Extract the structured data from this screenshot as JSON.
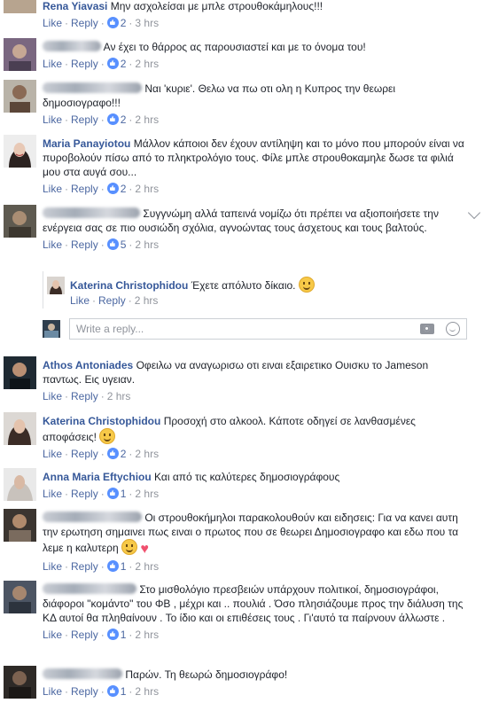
{
  "actions": {
    "like": "Like",
    "reply": "Reply",
    "sep": "·"
  },
  "comments": [
    {
      "name": "Rena Yiavasi",
      "text": "Μην ασχολείσαι με μπλε στρουθοκάμηλους!!!",
      "reactions": "2",
      "time": "3 hrs"
    },
    {
      "name": "",
      "text": "Αν έχει το θάρρος ας παρουσιαστεί και με το όνομα του!",
      "reactions": "2",
      "time": "2 hrs"
    },
    {
      "name": "",
      "text": "Ναι 'κυριε'. Θελω να πω οτι ολη η Κυπρος την θεωρει δημοσιογραφο!!!",
      "reactions": "2",
      "time": "2 hrs"
    },
    {
      "name": "Maria Panayiotou",
      "text": "Μάλλον κάποιοι δεν έχουν αντίληψη και το μόνο που μπορούν είναι να πυροβολούν πίσω από το πληκτρολόγιο τους. Φίλε μπλε στρουθοκαμηλε δωσε τα φιλιά μου στα αυγά σου...",
      "reactions": "2",
      "time": "2 hrs"
    },
    {
      "name": "",
      "text": "Συγγνώμη αλλά ταπεινά νομίζω ότι πρέπει να αξιοποιήσετε την ενέργεια σας σε πιο ουσιώδη σχόλια, αγνοώντας τους άσχετους και τους βαλτούς.",
      "reactions": "5",
      "time": "2 hrs"
    },
    {
      "name": "Athos Antoniades",
      "text": "Οφειλω να αναγωρισω οτι ειναι εξαιρετικο Ουισκυ το Jameson παντως. Εις υγειαν.",
      "reactions": "",
      "time": "2 hrs"
    },
    {
      "name": "Katerina Christophidou",
      "text": "Προσοχή στο αλκοολ. Κάποτε οδηγεί σε λανθασμένες αποφάσεις!",
      "reactions": "2",
      "time": "2 hrs"
    },
    {
      "name": "Anna Maria Eftychiou",
      "text": "Και από τις καλύτερες δημοσιογράφους",
      "reactions": "1",
      "time": "2 hrs"
    },
    {
      "name": "",
      "text": "Οι στρουθοκήμηλοι παρακολουθούν και ειδησεις: Για να κανει αυτη την ερωτηση σημαινει πως ειναι ο πρωτος που σε θεωρει Δημοσιογραφο και εδω που τα λεμε η καλυτερη",
      "reactions": "1",
      "time": "2 hrs"
    },
    {
      "name": "",
      "text": "Στο μισθολόγιο πρεσβειών υπάρχουν πολιτικοί, δημοσιογράφοι, διάφοροι \"κομάντο\" του ΦΒ , μέχρι και .. πουλιά . Όσο πλησιάζουμε προς την διάλυση της ΚΔ αυτοί θα πληθαίνουν . Το ίδιο και οι επιθέσεις τους . Γι'αυτό τα παίρνουν άλλωστε .",
      "reactions": "1",
      "time": "2 hrs"
    },
    {
      "name": "",
      "text": "Παρών. Τη θεωρώ δημοσιογράφο!",
      "reactions": "1",
      "time": "2 hrs"
    }
  ],
  "nested_reply": {
    "name": "Katerina Christophidou",
    "text": "Έχετε απόλυτο δίκαιο.",
    "time": "2 hrs"
  },
  "reply_box": {
    "placeholder": "Write a reply..."
  },
  "icons": {
    "reaction": "like-reaction-icon",
    "camera": "camera-icon",
    "emoji": "emoji-icon",
    "chevron": "chevron-down-icon"
  },
  "colors": {
    "name": "#365899",
    "link": "#4b67a1",
    "meta": "#90949c",
    "reaction": "#5890ff"
  }
}
